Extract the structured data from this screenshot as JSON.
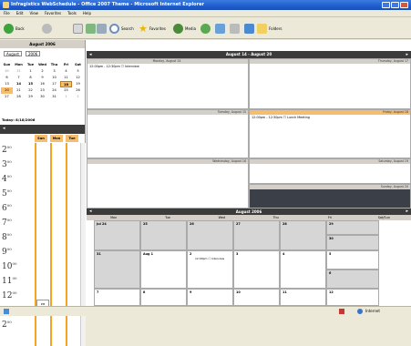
{
  "window": {
    "title": "Infragistics WebSchedule - Office 2007 Theme - Microsoft Internet Explorer"
  },
  "menu": [
    "File",
    "Edit",
    "View",
    "Favorites",
    "Tools",
    "Help"
  ],
  "toolbar": {
    "back": "Back",
    "search": "Search",
    "favorites": "Favorites",
    "media": "Media",
    "folders": "Folders"
  },
  "calendar": {
    "title": "August 2006",
    "month_select": "August",
    "year_select": "2006",
    "dow": [
      "Sun",
      "Mon",
      "Tue",
      "Wed",
      "Thu",
      "Fri",
      "Sat"
    ],
    "weeks": [
      [
        "30",
        "31",
        "1",
        "2",
        "3",
        "4",
        "5"
      ],
      [
        "6",
        "7",
        "8",
        "9",
        "10",
        "11",
        "12"
      ],
      [
        "13",
        "14",
        "15",
        "16",
        "17",
        "18",
        "19"
      ],
      [
        "20",
        "21",
        "22",
        "23",
        "24",
        "25",
        "26"
      ],
      [
        "27",
        "28",
        "29",
        "30",
        "31",
        "1",
        "2"
      ]
    ],
    "today_label": "Today: 8/18/2006"
  },
  "dayview": {
    "cols": [
      "Sun",
      "Mon",
      "Tue"
    ],
    "hours": [
      "2",
      "3",
      "4",
      "5",
      "6",
      "7",
      "8",
      "9",
      "10",
      "11",
      "12",
      "1",
      "2"
    ],
    "suffix": "00",
    "pm_label": "PM"
  },
  "week": {
    "title": "August 14 - August 20",
    "days": [
      {
        "label": "Monday, August 14",
        "event": "12:00pm - 12:30pm ☐ Interview"
      },
      {
        "label": "Thursday, August 17",
        "event": ""
      },
      {
        "label": "Tuesday, August 15",
        "event": ""
      },
      {
        "label": "Friday, August 18",
        "event": "12:00pm - 12:30pm ☐ Lunch Meeting"
      },
      {
        "label": "Wednesday, August 16",
        "event": ""
      },
      {
        "label": "Saturday, August 19",
        "event": ""
      },
      {
        "label": "Sunday, August 20",
        "event": ""
      }
    ]
  },
  "month": {
    "title": "August 2006",
    "dow": [
      "Mon",
      "Tue",
      "Wed",
      "Thu",
      "Fri",
      "Sat/Sun"
    ],
    "rows": [
      [
        "Jul 24",
        "25",
        "26",
        "27",
        "28",
        "29"
      ],
      [
        "31",
        "Aug 1",
        "2",
        "3",
        "4",
        "5"
      ],
      [
        "7",
        "8",
        "9",
        "10",
        "11",
        "12"
      ]
    ],
    "event": "12:00pm ☐ Interview",
    "sun_nums": [
      "30",
      "6"
    ]
  },
  "status": {
    "zone": "Internet"
  }
}
